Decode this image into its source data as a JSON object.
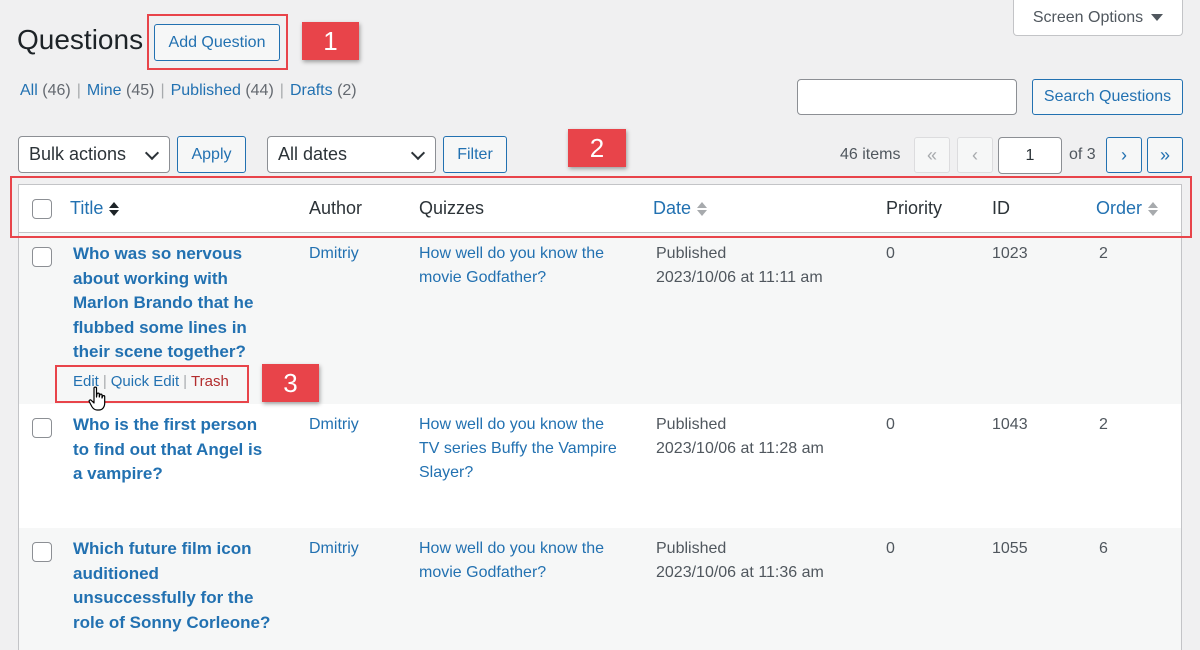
{
  "header": {
    "screen_options_label": "Screen Options",
    "title": "Questions",
    "add_button_label": "Add Question"
  },
  "callouts": [
    "1",
    "2",
    "3"
  ],
  "filters": [
    {
      "label": "All",
      "count": "(46)"
    },
    {
      "label": "Mine",
      "count": "(45)"
    },
    {
      "label": "Published",
      "count": "(44)"
    },
    {
      "label": "Drafts",
      "count": "(2)"
    }
  ],
  "search": {
    "value": "",
    "button_label": "Search Questions"
  },
  "toolbar": {
    "bulk_label": "Bulk actions",
    "apply_label": "Apply",
    "dates_label": "All dates",
    "filter_label": "Filter",
    "items_count": "46 items",
    "first": "«",
    "prev": "‹",
    "current_page": "1",
    "of_pages": "of 3",
    "next": "›",
    "last": "»"
  },
  "columns": {
    "title": "Title",
    "author": "Author",
    "quizzes": "Quizzes",
    "date": "Date",
    "priority": "Priority",
    "id": "ID",
    "order": "Order"
  },
  "rows": [
    {
      "title": "Who was so nervous about working with Marlon Brando that he flubbed some lines in their scene together?",
      "author": "Dmitriy",
      "quiz": "How well do you know the movie Godfather?",
      "status": "Published",
      "date": "2023/10/06 at 11:11 am",
      "priority": "0",
      "id": "1023",
      "order": "2"
    },
    {
      "title": "Who is the first person to find out that Angel is a vampire?",
      "author": "Dmitriy",
      "quiz": "How well do you know the TV series Buffy the Vampire Slayer?",
      "status": "Published",
      "date": "2023/10/06 at 11:28 am",
      "priority": "0",
      "id": "1043",
      "order": "2"
    },
    {
      "title": "Which future film icon auditioned unsuccessfully for the role of Sonny Corleone?",
      "author": "Dmitriy",
      "quiz": "How well do you know the movie Godfather?",
      "status": "Published",
      "date": "2023/10/06 at 11:36 am",
      "priority": "0",
      "id": "1055",
      "order": "6"
    }
  ],
  "row_actions": {
    "edit": "Edit",
    "quick_edit": "Quick Edit",
    "trash": "Trash",
    "sep": "|"
  }
}
